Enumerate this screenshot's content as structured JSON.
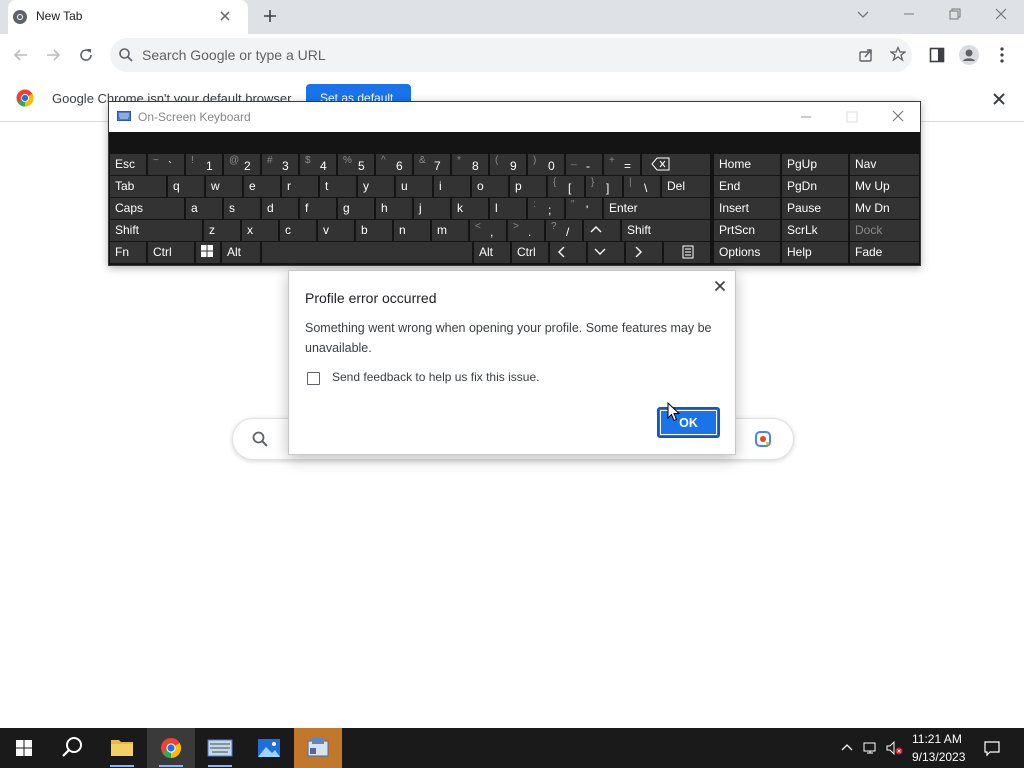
{
  "browser": {
    "tab_title": "New Tab",
    "omnibox_placeholder": "Search Google or type a URL",
    "infobar_text": "Google Chrome isn't your default browser",
    "set_default_label": "Set as default"
  },
  "osk": {
    "title": "On-Screen Keyboard",
    "keys": {
      "esc": "Esc",
      "tab": "Tab",
      "caps": "Caps",
      "shift": "Shift",
      "fn": "Fn",
      "ctrl": "Ctrl",
      "alt": "Alt",
      "del": "Del",
      "enter": "Enter",
      "shift_r": "Shift",
      "alt_r": "Alt",
      "ctrl_r": "Ctrl",
      "home": "Home",
      "pgup": "PgUp",
      "nav": "Nav",
      "end": "End",
      "pgdn": "PgDn",
      "mvup": "Mv Up",
      "insert": "Insert",
      "pause": "Pause",
      "mvdn": "Mv Dn",
      "prtscn": "PrtScn",
      "scrlk": "ScrLk",
      "dock": "Dock",
      "options": "Options",
      "help": "Help",
      "fade": "Fade"
    },
    "number_row": [
      {
        "shift": "~",
        "main": "`"
      },
      {
        "shift": "!",
        "main": "1"
      },
      {
        "shift": "@",
        "main": "2"
      },
      {
        "shift": "#",
        "main": "3"
      },
      {
        "shift": "$",
        "main": "4"
      },
      {
        "shift": "%",
        "main": "5"
      },
      {
        "shift": "^",
        "main": "6"
      },
      {
        "shift": "&",
        "main": "7"
      },
      {
        "shift": "*",
        "main": "8"
      },
      {
        "shift": "(",
        "main": "9"
      },
      {
        "shift": ")",
        "main": "0"
      },
      {
        "shift": "_",
        "main": "-"
      },
      {
        "shift": "+",
        "main": "="
      }
    ],
    "row_q": [
      "q",
      "w",
      "e",
      "r",
      "t",
      "y",
      "u",
      "i",
      "o",
      "p"
    ],
    "row_q_sym": [
      {
        "shift": "{",
        "main": "["
      },
      {
        "shift": "}",
        "main": "]"
      },
      {
        "shift": "|",
        "main": "\\"
      }
    ],
    "row_a": [
      "a",
      "s",
      "d",
      "f",
      "g",
      "h",
      "j",
      "k",
      "l"
    ],
    "row_a_sym": [
      {
        "shift": ":",
        "main": ";"
      },
      {
        "shift": "\"",
        "main": "'"
      }
    ],
    "row_z": [
      "z",
      "x",
      "c",
      "v",
      "b",
      "n",
      "m"
    ],
    "row_z_sym": [
      {
        "shift": "<",
        "main": ","
      },
      {
        "shift": ">",
        "main": "."
      },
      {
        "shift": "?",
        "main": "/"
      }
    ]
  },
  "dialog": {
    "title": "Profile error occurred",
    "body": "Something went wrong when opening your profile. Some features may be unavailable.",
    "checkbox_label": "Send feedback to help us fix this issue.",
    "ok_label": "OK"
  },
  "taskbar": {
    "time": "11:21 AM",
    "date": "9/13/2023"
  },
  "colors": {
    "accent": "#1a73e8",
    "osk_bg": "#141414",
    "osk_key": "#333333",
    "taskbar": "#1a1a1a"
  }
}
